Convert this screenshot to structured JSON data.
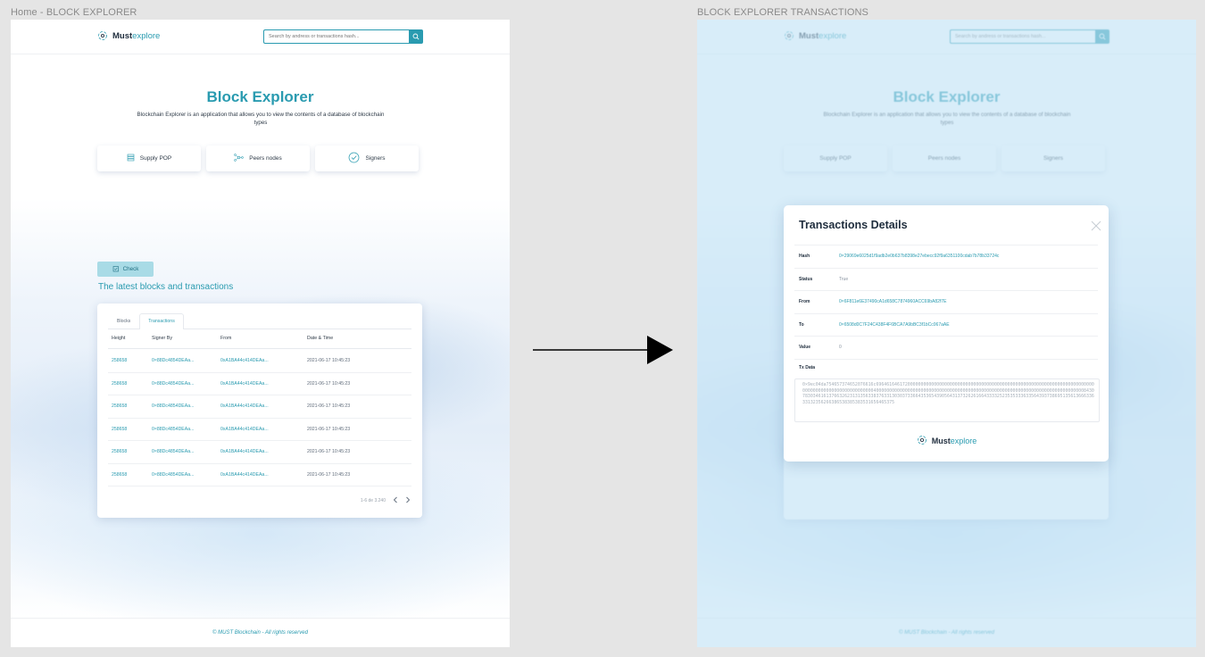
{
  "frames": {
    "left_label": "Home - BLOCK EXPLORER",
    "right_label": "BLOCK EXPLORER TRANSACTIONS"
  },
  "header": {
    "logo_bold": "Must",
    "logo_light": "explore",
    "search_placeholder": "Search by andress or transactions hash..."
  },
  "hero": {
    "title": "Block Explorer",
    "description": "Blockchain Explorer is an application that allows you to view the contents of a database of blockchain types"
  },
  "stats": {
    "supply": "Supply POP",
    "peers": "Peers nodes",
    "signers": "Signers"
  },
  "check_label": "Check",
  "latest_title": "The latest blocks and transactions",
  "table": {
    "tabs": [
      "Blocks",
      "Transactions"
    ],
    "active_tab": "Transactions",
    "columns": [
      "Height",
      "Signer By",
      "From",
      "Date & Time"
    ],
    "rows": [
      {
        "height": "258658",
        "signer": "0×88Dc4854DEAa...",
        "from": "0xA1BA44c414DEAa...",
        "date": "2021-06-17 10:45:23"
      },
      {
        "height": "258658",
        "signer": "0×88Dc4854DEAa...",
        "from": "0xA1BA44c414DEAa...",
        "date": "2021-06-17 10:45:23"
      },
      {
        "height": "258658",
        "signer": "0×88Dc4854DEAa...",
        "from": "0xA1BA44c414DEAa...",
        "date": "2021-06-17 10:45:23"
      },
      {
        "height": "258658",
        "signer": "0×88Dc4854DEAa...",
        "from": "0xA1BA44c414DEAa...",
        "date": "2021-06-17 10:45:23"
      },
      {
        "height": "258658",
        "signer": "0×88Dc4854DEAa...",
        "from": "0xA1BA44c414DEAa...",
        "date": "2021-06-17 10:45:23"
      },
      {
        "height": "258658",
        "signer": "0×88Dc4854DEAa...",
        "from": "0xA1BA44c414DEAa...",
        "date": "2021-06-17 10:45:23"
      }
    ],
    "pagination": "1-6 de 3.240"
  },
  "footer": "© MUST Blockchain - All rights reserved",
  "modal": {
    "title": "Transactions Details",
    "hash_label": "Hash",
    "hash": "0×29069e6025d1f9adb2e0b637b8398e27ebecc92f9a6351100cdab7b78b33724c",
    "status_label": "Status",
    "status": "True",
    "from_label": "From",
    "from": "0×6F811e6E37490cA1d658C7874960ACC69bA82f7E",
    "to_label": "To",
    "to": "0×6508d0C7F24C438F4F6BCA7A9bBC3f1bCc067aAE",
    "value_label": "Value",
    "value": "0",
    "txdata_label": "Tx Data",
    "txdata": "0×9ec04da754657374652076616c6964616461720000000000000000000000000000000000000000000000000000000000000000000000000000000000000000000000000040000000000000000000000000000000000000000000000000000000000000000000000000000000843078303461613766326231313563383763313030373366435365439056431373262616643333252353533363356439373869513561366633633132356266386538385383531656465375"
  },
  "colors": {
    "accent": "#2a9bb0",
    "dark_text": "#1f2d3d",
    "overlay": "#c0e2f6"
  }
}
